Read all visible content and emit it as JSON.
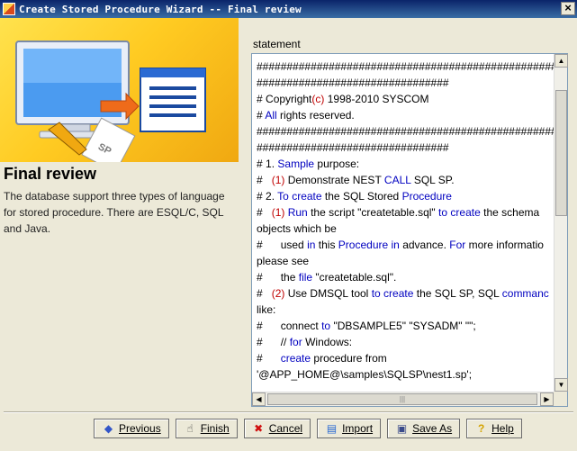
{
  "window": {
    "title": "Create Stored Procedure Wizard -- Final review",
    "close_glyph": "×"
  },
  "left": {
    "heading": "Final review",
    "description": "The database support three types of language for stored procedure. There are ESQL/C, SQL and Java."
  },
  "statement_label": "statement",
  "code_lines": [
    "##################################################",
    "################################",
    "# Copyright(c) 1998-2010 SYSCOM",
    "# All rights reserved.",
    "##################################################",
    "################################",
    "# 1. Sample purpose:",
    "#   (1) Demonstrate NEST CALL SQL SP.",
    "# 2. To create the SQL Stored Procedure",
    "#   (1) Run the script \"createtable.sql\" to create the schema",
    "objects which be",
    "#      used in this Procedure in advance. For more informatio",
    "please see",
    "#      the file \"createtable.sql\".",
    "#   (2) Use DMSQL tool to create the SQL SP, SQL commanc",
    "like:",
    "#      connect to \"DBSAMPLE5\" \"SYSADM\" \"\";",
    "#      // for Windows:",
    "#      create procedure from",
    "'@APP_HOME@\\samples\\SQLSP\\nest1.sp';"
  ],
  "buttons": {
    "previous": "Previous",
    "finish": "Finish",
    "cancel": "Cancel",
    "import": "Import",
    "save_as": "Save As",
    "help": "Help"
  },
  "icons": {
    "previous": "arrow-left-icon",
    "finish": "hand-pointer-icon",
    "cancel": "x-mark-icon",
    "import": "folder-open-icon",
    "save_as": "save-disk-icon",
    "help": "question-mark-icon"
  },
  "colors": {
    "titlebar": "#0a246a",
    "keyword": "#0000c0",
    "banner": "#ffcb22"
  }
}
